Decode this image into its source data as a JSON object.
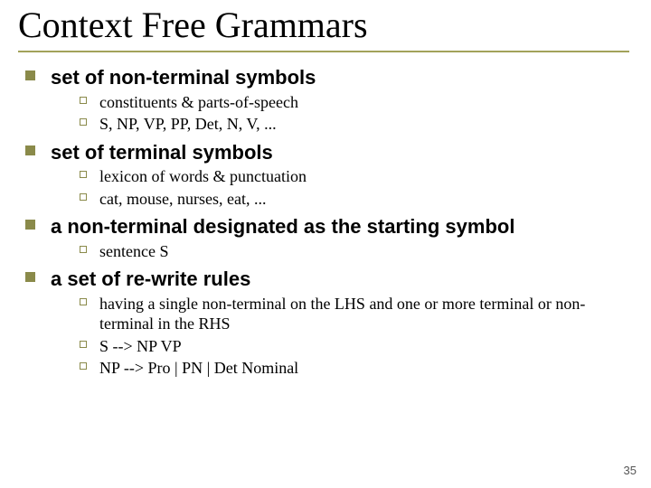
{
  "title": "Context Free Grammars",
  "page_number": "35",
  "items": [
    {
      "heading": "set of non-terminal symbols",
      "sub": [
        "constituents & parts-of-speech",
        "S, NP, VP, PP, Det, N, V, ..."
      ]
    },
    {
      "heading": "set of terminal symbols",
      "sub": [
        "lexicon of words & punctuation",
        "cat, mouse, nurses, eat, ..."
      ]
    },
    {
      "heading": "a non-terminal designated as the starting symbol",
      "sub": [
        "sentence S"
      ]
    },
    {
      "heading": "a set of re-write rules",
      "sub": [
        "having a single non-terminal on the LHS and one or more terminal or non-terminal in the RHS",
        "S --> NP VP",
        "NP --> Pro | PN | Det Nominal"
      ]
    }
  ]
}
